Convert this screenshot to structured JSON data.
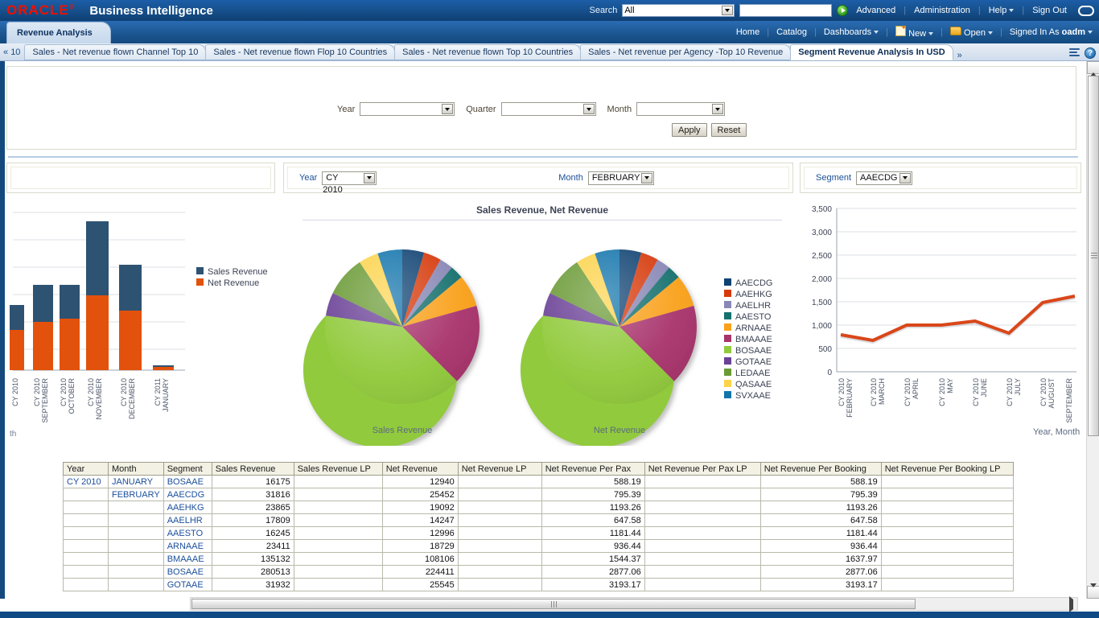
{
  "header": {
    "logo": "ORACLE",
    "logo_mark": "®",
    "app_title": "Business Intelligence",
    "search_label": "Search",
    "search_scope": "All",
    "search_placeholder": "",
    "search_value": "",
    "go_icon": "go-arrow-icon",
    "advanced": "Advanced",
    "administration": "Administration",
    "help": "Help",
    "sign_out": "Sign Out",
    "avatar_icon": "user-bubble-icon"
  },
  "nav": {
    "dashboard_tab": "Revenue Analysis",
    "home": "Home",
    "catalog": "Catalog",
    "dashboards": "Dashboards",
    "new": "New",
    "open": "Open",
    "signed_in_as_label": "Signed In As",
    "signed_in_user": "oadm"
  },
  "page_tabs": {
    "prev_label": "10",
    "prev_icon": "double-chevron-left-icon",
    "more_icon": "double-chevron-right-icon",
    "items": [
      {
        "label": "Sales - Net revenue flown Channel Top 10",
        "active": false
      },
      {
        "label": "Sales - Net revenue flown Flop 10 Countries",
        "active": false
      },
      {
        "label": "Sales - Net revenue flown Top 10 Countries",
        "active": false
      },
      {
        "label": "Sales - Net revenue per Agency -Top 10 Revenue",
        "active": false
      },
      {
        "label": "Segment Revenue Analysis In USD",
        "active": true
      }
    ],
    "options_icon": "list-options-icon",
    "help_icon": "help-circle-icon"
  },
  "prompt": {
    "year_label": "Year",
    "year_value": "",
    "quarter_label": "Quarter",
    "quarter_value": "",
    "month_label": "Month",
    "month_value": "",
    "apply_label": "Apply",
    "reset_label": "Reset",
    "dropdown_icon": "chevron-down-icon"
  },
  "section_prompts": {
    "middle": {
      "year_label": "Year",
      "year_value": "CY 2010",
      "month_label": "Month",
      "month_value": "FEBRUARY"
    },
    "right": {
      "segment_label": "Segment",
      "segment_value": "AAECDG"
    }
  },
  "colors": {
    "sales_revenue": "#2e5272",
    "net_revenue": "#e2520c",
    "line_series": "#d9471a",
    "oracle_red": "#f01000",
    "header_blue": "#17528f",
    "link_blue": "#1b4f9c"
  },
  "chart_data": [
    {
      "id": "bar-chart",
      "type": "bar",
      "stacked": true,
      "title": "",
      "xlabel": "Year, Month",
      "xlabel_visible_fragment": "th",
      "ylabel": "",
      "categories": [
        "CY 2010",
        "CY 2010 SEPTEMBER",
        "CY 2010 OCTOBER",
        "CY 2010 NOVEMBER",
        "CY 2010 DECEMBER",
        "CY 2011 JANUARY"
      ],
      "series": [
        {
          "name": "Net Revenue",
          "color": "#e2520c",
          "values": [
            52,
            105,
            118,
            210,
            160,
            3
          ]
        },
        {
          "name": "Sales Revenue",
          "color": "#2e5272",
          "values": [
            43,
            57,
            48,
            138,
            97,
            2
          ]
        }
      ],
      "legend": [
        "Sales Revenue",
        "Net Revenue"
      ],
      "legend_position": "right",
      "grid": true,
      "note": "left chart is horizontally clipped by panel scroll"
    },
    {
      "id": "sales-revenue-pie",
      "type": "pie",
      "title": "Sales Revenue, Net Revenue",
      "caption": "Sales Revenue",
      "labels": [
        "AAECDG",
        "AAEHKG",
        "AAELHR",
        "AAESTO",
        "ARNAAE",
        "BMAAAE",
        "BOSAAE",
        "GOTAAE",
        "LEDAAE",
        "QASAAE",
        "SVXAAE"
      ],
      "values": [
        31816,
        23865,
        17809,
        16245,
        23411,
        135132,
        280513,
        31932,
        72000,
        26000,
        38000
      ],
      "colors": [
        "#0f4272",
        "#d63a0b",
        "#8887b6",
        "#16706e",
        "#f9a11b",
        "#a8336c",
        "#91ca3c",
        "#6a4196",
        "#6a9a35",
        "#fcd34b",
        "#1274ab"
      ]
    },
    {
      "id": "net-revenue-pie",
      "type": "pie",
      "title": "Sales Revenue, Net Revenue",
      "caption": "Net Revenue",
      "labels": [
        "AAECDG",
        "AAEHKG",
        "AAELHR",
        "AAESTO",
        "ARNAAE",
        "BMAAAE",
        "BOSAAE",
        "GOTAAE",
        "LEDAAE",
        "QASAAE",
        "SVXAAE"
      ],
      "values": [
        25452,
        19092,
        14247,
        12996,
        18729,
        108106,
        224411,
        25545,
        57600,
        20800,
        30400
      ],
      "colors": [
        "#0f4272",
        "#d63a0b",
        "#8887b6",
        "#16706e",
        "#f9a11b",
        "#a8336c",
        "#91ca3c",
        "#6a4196",
        "#6a9a35",
        "#fcd34b",
        "#1274ab"
      ]
    },
    {
      "id": "line-chart",
      "type": "line",
      "title": "",
      "xlabel": "Year, Month",
      "ylabel": "",
      "ylim": [
        0,
        3500
      ],
      "yticks": [
        "0",
        "500",
        "1,000",
        "1,500",
        "2,000",
        "2,500",
        "3,000",
        "3,500"
      ],
      "categories": [
        "CY 2010 FEBRUARY",
        "CY 2010 MARCH",
        "CY 2010 APRIL",
        "CY 2010 MAY",
        "CY 2010 JUNE",
        "CY 2010 JULY",
        "CY 2010 AUGUST",
        "CY 2010 SEPTEMBER"
      ],
      "series": [
        {
          "name": "Net Revenue Per Pax",
          "color": "#d9471a",
          "values": [
            795,
            650,
            970,
            965,
            1060,
            800,
            1450,
            1610
          ]
        }
      ],
      "grid": true
    }
  ],
  "pie_legend": {
    "items": [
      {
        "label": "AAECDG",
        "color": "#0f4272"
      },
      {
        "label": "AAEHKG",
        "color": "#d63a0b"
      },
      {
        "label": "AAELHR",
        "color": "#8887b6"
      },
      {
        "label": "AAESTO",
        "color": "#16706e"
      },
      {
        "label": "ARNAAE",
        "color": "#f9a11b"
      },
      {
        "label": "BMAAAE",
        "color": "#a8336c"
      },
      {
        "label": "BOSAAE",
        "color": "#91ca3c"
      },
      {
        "label": "GOTAAE",
        "color": "#6a4196"
      },
      {
        "label": "LEDAAE",
        "color": "#6a9a35"
      },
      {
        "label": "QASAAE",
        "color": "#fcd34b"
      },
      {
        "label": "SVXAAE",
        "color": "#1274ab"
      }
    ]
  },
  "table": {
    "columns": [
      "Year",
      "Month",
      "Segment",
      "Sales Revenue",
      "Sales Revenue LP",
      "Net Revenue",
      "Net Revenue LP",
      "Net Revenue Per Pax",
      "Net Revenue Per Pax LP",
      "Net Revenue Per Booking",
      "Net Revenue Per Booking LP"
    ],
    "rows": [
      [
        "CY 2010",
        "JANUARY",
        "BOSAAE",
        "16175",
        "",
        "12940",
        "",
        "588.19",
        "",
        "588.19",
        ""
      ],
      [
        "",
        "FEBRUARY",
        "AAECDG",
        "31816",
        "",
        "25452",
        "",
        "795.39",
        "",
        "795.39",
        ""
      ],
      [
        "",
        "",
        "AAEHKG",
        "23865",
        "",
        "19092",
        "",
        "1193.26",
        "",
        "1193.26",
        ""
      ],
      [
        "",
        "",
        "AAELHR",
        "17809",
        "",
        "14247",
        "",
        "647.58",
        "",
        "647.58",
        ""
      ],
      [
        "",
        "",
        "AAESTO",
        "16245",
        "",
        "12996",
        "",
        "1181.44",
        "",
        "1181.44",
        ""
      ],
      [
        "",
        "",
        "ARNAAE",
        "23411",
        "",
        "18729",
        "",
        "936.44",
        "",
        "936.44",
        ""
      ],
      [
        "",
        "",
        "BMAAAE",
        "135132",
        "",
        "108106",
        "",
        "1544.37",
        "",
        "1637.97",
        ""
      ],
      [
        "",
        "",
        "BOSAAE",
        "280513",
        "",
        "224411",
        "",
        "2877.06",
        "",
        "2877.06",
        ""
      ],
      [
        "",
        "",
        "GOTAAE",
        "31932",
        "",
        "25545",
        "",
        "3193.17",
        "",
        "3193.17",
        ""
      ]
    ]
  },
  "scroll": {
    "vertical_up_icon": "triangle-up-icon",
    "vertical_down_icon": "triangle-down-icon",
    "horizontal_right_icon": "triangle-right-icon"
  }
}
